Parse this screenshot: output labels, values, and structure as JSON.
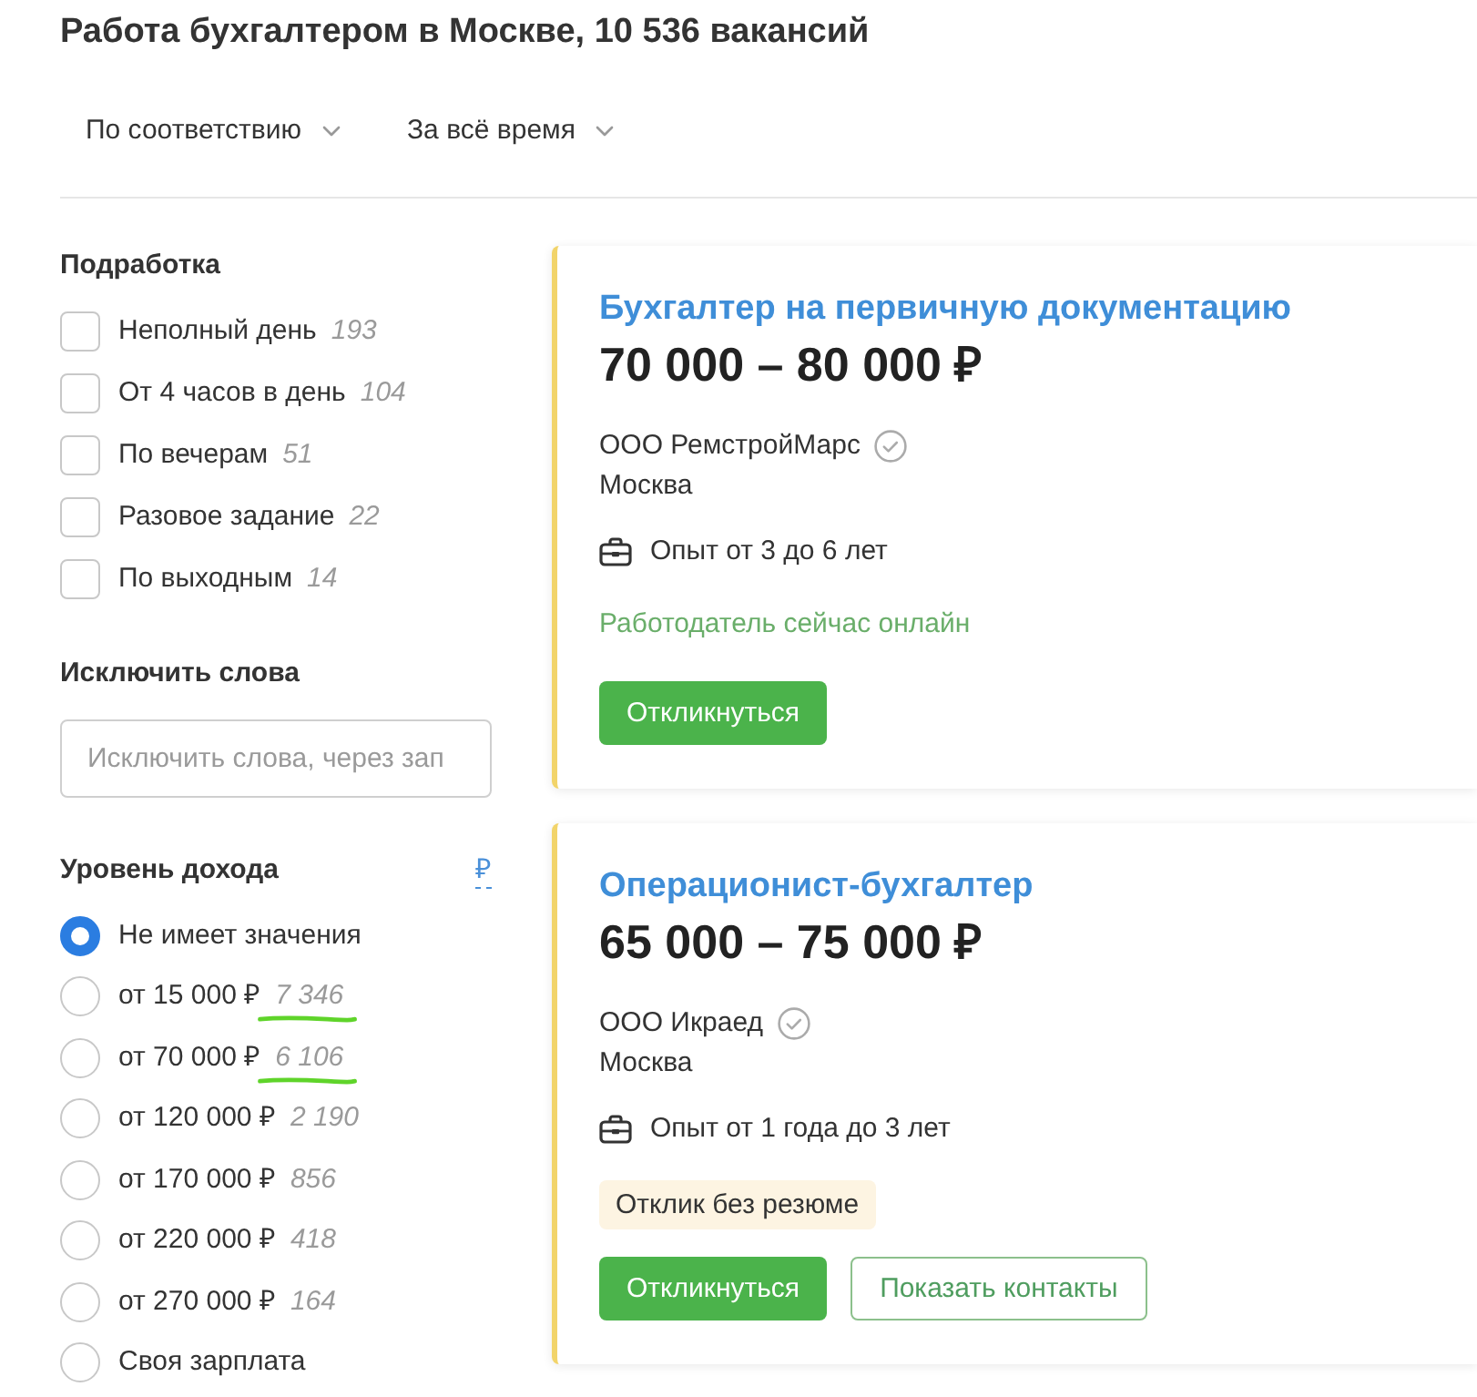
{
  "page": {
    "title": "Работа бухгалтером в Москве, 10 536 вакансий"
  },
  "sort_controls": [
    {
      "label": "По соответствию"
    },
    {
      "label": "За всё время"
    }
  ],
  "filters": {
    "part_time": {
      "title": "Подработка",
      "options": [
        {
          "label": "Неполный день",
          "count": "193",
          "checked": false
        },
        {
          "label": "От 4 часов в день",
          "count": "104",
          "checked": false
        },
        {
          "label": "По вечерам",
          "count": "51",
          "checked": false
        },
        {
          "label": "Разовое задание",
          "count": "22",
          "checked": false
        },
        {
          "label": "По выходным",
          "count": "14",
          "checked": false
        }
      ]
    },
    "exclude_words": {
      "title": "Исключить слова",
      "placeholder": "Исключить слова, через зап"
    },
    "income": {
      "title": "Уровень дохода",
      "currency": "₽",
      "options": [
        {
          "label": "Не имеет значения",
          "selected": true,
          "highlighted": false
        },
        {
          "label": "от 15 000 ₽",
          "count": "7 346",
          "selected": false,
          "highlighted": true
        },
        {
          "label": "от 70 000 ₽",
          "count": "6 106",
          "selected": false,
          "highlighted": true
        },
        {
          "label": "от 120 000 ₽",
          "count": "2 190",
          "selected": false,
          "highlighted": false
        },
        {
          "label": "от 170 000 ₽",
          "count": "856",
          "selected": false,
          "highlighted": false
        },
        {
          "label": "от 220 000 ₽",
          "count": "418",
          "selected": false,
          "highlighted": false
        },
        {
          "label": "от 270 000 ₽",
          "count": "164",
          "selected": false,
          "highlighted": false
        },
        {
          "label": "Своя зарплата",
          "selected": false,
          "highlighted": false
        }
      ]
    }
  },
  "vacancies": [
    {
      "title": "Бухгалтер на первичную документацию",
      "salary": "70 000 – 80 000 ₽",
      "company": "ООО РемстройМарс",
      "verified": true,
      "city": "Москва",
      "experience": "Опыт от 3 до 6 лет",
      "online_status": "Работодатель сейчас онлайн",
      "buttons": [
        {
          "label": "Откликнуться",
          "kind": "filled"
        }
      ]
    },
    {
      "title": "Операционист-бухгалтер",
      "salary": "65 000 – 75 000 ₽",
      "company": "ООО Икраед",
      "verified": true,
      "city": "Москва",
      "experience": "Опыт от 1 года до 3 лет",
      "badge": "Отклик без резюме",
      "buttons": [
        {
          "label": "Откликнуться",
          "kind": "filled"
        },
        {
          "label": "Показать контакты",
          "kind": "outlined"
        }
      ]
    }
  ]
}
